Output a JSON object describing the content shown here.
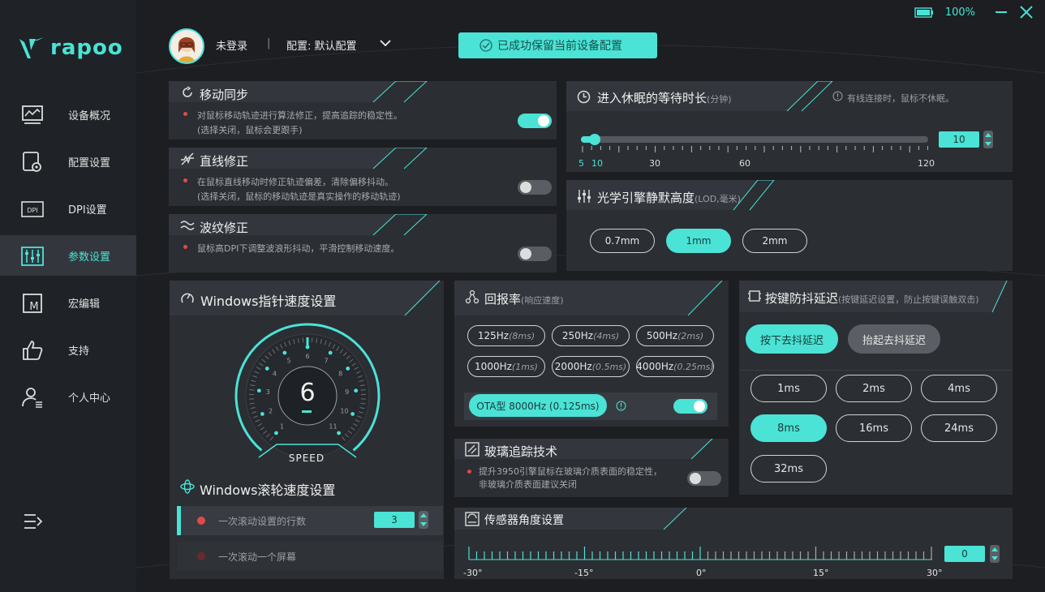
{
  "app": {
    "logo_text": "rapoo",
    "battery": "100%"
  },
  "header": {
    "user": "未登录",
    "separator": "|",
    "config": "配置: 默认配置",
    "toast": "已成功保留当前设备配置"
  },
  "sidebar": {
    "items": [
      {
        "label": "设备概况",
        "icon": "chart-monitor-icon"
      },
      {
        "label": "配置设置",
        "icon": "config-gear-icon"
      },
      {
        "label": "DPI设置",
        "icon": "dpi-icon"
      },
      {
        "label": "参数设置",
        "icon": "sliders-icon"
      },
      {
        "label": "宏编辑",
        "icon": "macro-icon"
      },
      {
        "label": "支持",
        "icon": "thumbs-up-icon"
      },
      {
        "label": "个人中心",
        "icon": "user-icon"
      }
    ]
  },
  "motion_sync": {
    "title": "移动同步",
    "desc1": "对鼠标移动轨迹进行算法修正，提高追踪的稳定性。",
    "desc2": "(选择关闭，鼠标会更跟手)",
    "enabled": true
  },
  "angle_snap": {
    "title": "直线修正",
    "desc1": "在鼠标直线移动时修正轨迹偏差，清除偏移抖动。",
    "desc2": "(选择关闭，鼠标的移动轨迹是真实操作的移动轨迹)",
    "enabled": false
  },
  "ripple": {
    "title": "波纹修正",
    "desc1": "鼠标高DPI下调整波浪形抖动，平滑控制移动速度。",
    "enabled": false
  },
  "sleep": {
    "title": "进入休眠的等待时长",
    "unit": "(分钟)",
    "note": "有线连接时，鼠标不休眠。",
    "value": "10",
    "ticks": [
      "5",
      "10",
      "30",
      "60",
      "120"
    ]
  },
  "lod": {
    "title": "光学引擎静默高度",
    "unit": "(LOD,毫米)",
    "options": [
      "0.7mm",
      "1mm",
      "2mm"
    ],
    "selected": 1
  },
  "pointer_speed": {
    "title": "Windows指针速度设置",
    "value": "6",
    "speed_label": "SPEED",
    "scale": [
      "1",
      "2",
      "3",
      "4",
      "5",
      "6",
      "7",
      "8",
      "9",
      "10",
      "11"
    ]
  },
  "scroll": {
    "title": "Windows滚轮速度设置",
    "lines_label": "一次滚动设置的行数",
    "lines_value": "3",
    "screen_label": "一次滚动一个屏幕"
  },
  "polling": {
    "title": "回报率",
    "unit": "(响应速度)",
    "options": [
      {
        "hz": "125Hz",
        "ms": "(8ms)"
      },
      {
        "hz": "250Hz",
        "ms": "(4ms)"
      },
      {
        "hz": "500Hz",
        "ms": "(2ms)"
      },
      {
        "hz": "1000Hz",
        "ms": "(1ms)"
      },
      {
        "hz": "2000Hz",
        "ms": "(0.5ms)"
      },
      {
        "hz": "4000Hz",
        "ms": "(0.25ms)"
      }
    ],
    "ota_label": "OTA型 8000Hz (0.125ms)",
    "ota_enabled": true
  },
  "glass": {
    "title": "玻璃追踪技术",
    "desc1": "提升3950引擎鼠标在玻璃介质表面的稳定性，",
    "desc2": "非玻璃介质表面建议关闭",
    "enabled": false
  },
  "debounce": {
    "title": "按键防抖延迟",
    "unit": "(按键延迟设置，防止按键误触双击)",
    "tab_press": "按下去抖延迟",
    "tab_release": "抬起去抖延迟",
    "options": [
      "1ms",
      "2ms",
      "4ms",
      "8ms",
      "16ms",
      "24ms",
      "32ms"
    ],
    "selected": 3
  },
  "sensor_angle": {
    "title": "传感器角度设置",
    "value": "0",
    "ticks": [
      "-30°",
      "-15°",
      "0°",
      "15°",
      "30°"
    ]
  },
  "colors": {
    "accent": "#4ae3d6",
    "bg": "#1c1e22",
    "panel": "#2b2e33",
    "red_dot": "#e04a4a"
  }
}
